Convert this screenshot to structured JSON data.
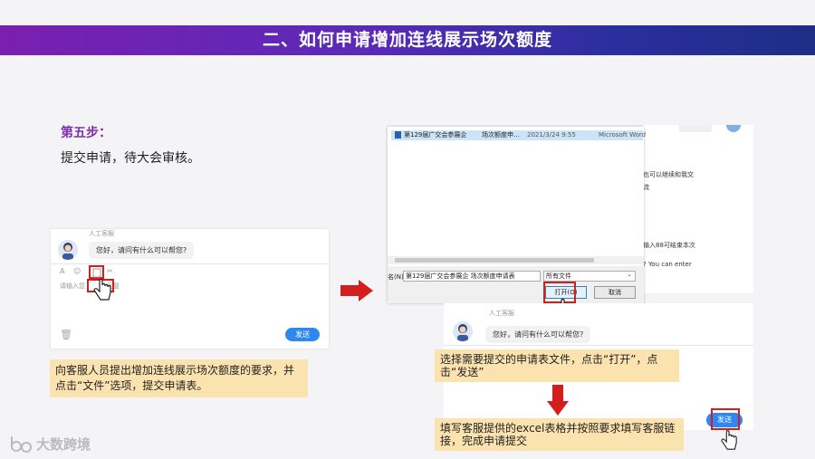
{
  "banner": {
    "title": "二、如何申请增加连线展示场次额度"
  },
  "step": {
    "title": "第五步：",
    "description": "提交申请，待大会审核。"
  },
  "left_chat": {
    "header": "人工客服",
    "greeting": "您好，请问有什么可以帮您?",
    "input_placeholder": "请输入您",
    "input_placeholder_tail": "回复",
    "send_label": "发送"
  },
  "left_caption": "向客服人员提出增加连线展示场次额度的要求，并点击“文件”选项，提交申请表。",
  "dialog": {
    "file_row": {
      "name": "第129届广交会参展企",
      "name2": "场次额度申...",
      "date": "2021/3/24 9:55",
      "type": "Microsoft Word"
    },
    "filename_label": "名(N):",
    "filename_value": "第129届广交会参展企 场次额度申请表",
    "filter_value": "所有文件",
    "open_label": "打开(O)",
    "cancel_label": "取消"
  },
  "right_snippets": {
    "line1": "也可以继续和我交",
    "line2": "流",
    "line3": "输入88可结束本次",
    "line4": "? You can enter"
  },
  "right_chat": {
    "header": "人工客服",
    "greeting": "您好，请问有什么可以帮您?",
    "send_label": "发送"
  },
  "caption_mid": "选择需要提交的申请表文件，点击“打开”，点击“发送”",
  "caption_bottom": "填写客服提供的excel表格并按照要求填写客服链接，完成申请提交",
  "logo_text": "大数跨境",
  "colors": {
    "accent_red": "#d41e1e",
    "banner_purple": "#7a1fb0",
    "send_blue": "#2f88f0"
  }
}
